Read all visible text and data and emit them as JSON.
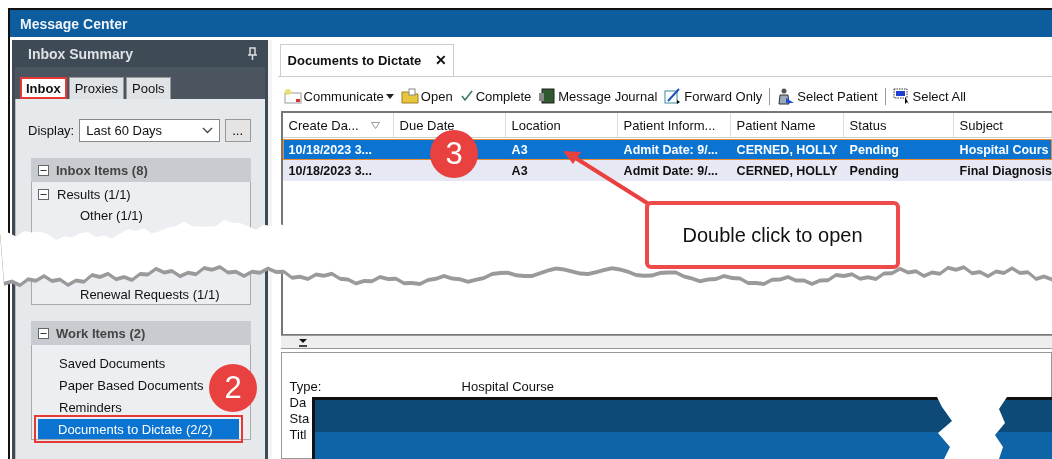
{
  "window": {
    "title": "Message Center"
  },
  "inbox_summary": {
    "title": "Inbox Summary",
    "tabs": [
      {
        "label": "Inbox",
        "selected": true,
        "highlighted": true
      },
      {
        "label": "Proxies",
        "selected": false,
        "highlighted": false
      },
      {
        "label": "Pools",
        "selected": false,
        "highlighted": false
      }
    ],
    "display": {
      "label": "Display:",
      "value": "Last 60 Days",
      "more_button": "..."
    },
    "inbox_items": {
      "title": "Inbox Items (8)",
      "expanded": true,
      "items": [
        {
          "label": "Results (1/1)",
          "expanded": true,
          "children": [
            {
              "label": "Other (1/1)"
            }
          ]
        },
        {
          "children": [
            {
              "label": "Renewal Requests (1/1)"
            }
          ]
        }
      ]
    },
    "work_items": {
      "title": "Work Items (2)",
      "expanded": true,
      "items": [
        {
          "label": "Saved Documents",
          "selected": false,
          "highlighted": false
        },
        {
          "label": "Paper Based Documents",
          "selected": false,
          "highlighted": false
        },
        {
          "label": "Reminders",
          "selected": false,
          "highlighted": false
        },
        {
          "label": "Documents to Dictate (2/2)",
          "selected": true,
          "highlighted": true
        }
      ]
    }
  },
  "document_tab": {
    "label": "Documents to Dictate",
    "close": "✕"
  },
  "toolbar": [
    {
      "label": "Communicate",
      "dropdown": true,
      "separator_before": false
    },
    {
      "label": "Open",
      "dropdown": false,
      "separator_before": false
    },
    {
      "label": "Complete",
      "dropdown": false,
      "separator_before": false
    },
    {
      "label": "Message Journal",
      "dropdown": false,
      "separator_before": false
    },
    {
      "label": "Forward Only",
      "dropdown": false,
      "separator_before": false
    },
    {
      "label": "Select Patient",
      "dropdown": false,
      "separator_before": true
    },
    {
      "label": "Select All",
      "dropdown": false,
      "separator_before": true
    }
  ],
  "table": {
    "columns": [
      {
        "label": "Create Da...",
        "sorted": true
      },
      {
        "label": "Due Date",
        "sorted": false
      },
      {
        "label": "Location",
        "sorted": false
      },
      {
        "label": "Patient Inform...",
        "sorted": false
      },
      {
        "label": "Patient Name",
        "sorted": false
      },
      {
        "label": "Status",
        "sorted": false
      },
      {
        "label": "Subject",
        "sorted": false
      }
    ],
    "rows": [
      {
        "selected": true,
        "cells": [
          "10/18/2023 3...",
          null,
          "A3",
          "Admit Date: 9/...",
          "CERNED, HOLLY",
          "Pending",
          "Hospital Cours"
        ]
      },
      {
        "selected": false,
        "cells": [
          "10/18/2023 3...",
          null,
          "A3",
          "Admit Date: 9/...",
          "CERNED, HOLLY",
          "Pending",
          "Final Diagnosis"
        ]
      }
    ]
  },
  "detail": {
    "fields": [
      {
        "label": "Type:",
        "value": "Hospital Course"
      },
      {
        "label": "Da"
      },
      {
        "label": "Sta"
      },
      {
        "label": "Titl"
      }
    ]
  },
  "annotations": [
    {
      "kind": "badge",
      "text": "3"
    },
    {
      "kind": "callout",
      "text": "Double click to open"
    },
    {
      "kind": "badge",
      "text": "2"
    }
  ]
}
